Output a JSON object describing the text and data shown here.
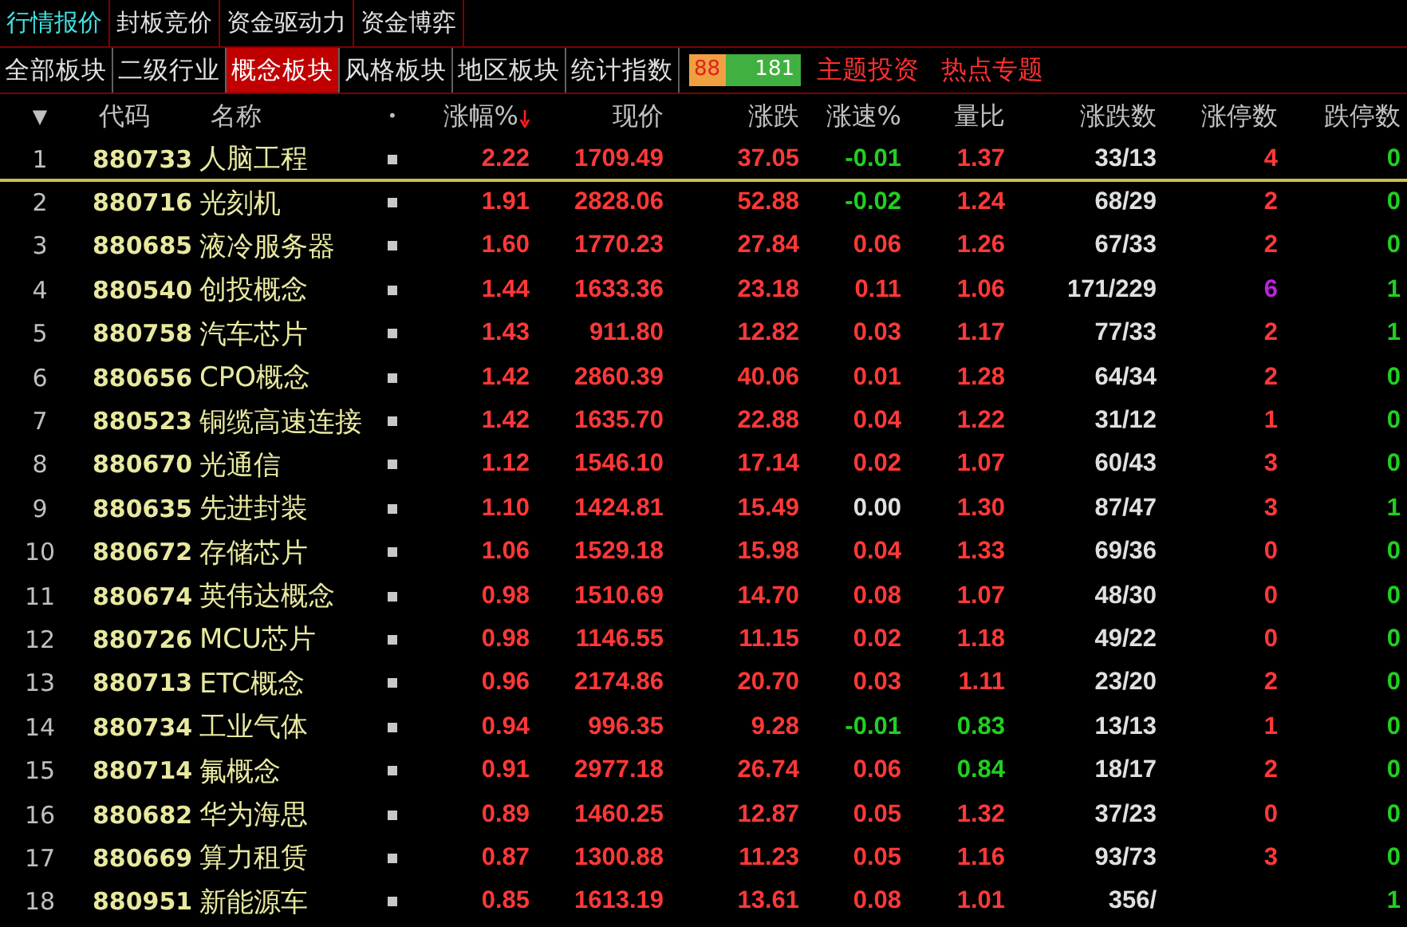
{
  "top_tabs": [
    {
      "label": "行情报价",
      "selected": true
    },
    {
      "label": "封板竞价",
      "selected": false
    },
    {
      "label": "资金驱动力",
      "selected": false
    },
    {
      "label": "资金博弈",
      "selected": false
    }
  ],
  "sector_tabs": [
    {
      "label": "全部板块",
      "selected": false
    },
    {
      "label": "二级行业",
      "selected": false
    },
    {
      "label": "概念板块",
      "selected": true
    },
    {
      "label": "风格板块",
      "selected": false
    },
    {
      "label": "地区板块",
      "selected": false
    },
    {
      "label": "统计指数",
      "selected": false
    }
  ],
  "breadth": {
    "up": "88",
    "down": "181",
    "level": 0.33
  },
  "links": [
    "主题投资",
    "热点专题"
  ],
  "columns": [
    "▼",
    "代码",
    "名称",
    "•",
    "涨幅%",
    "现价",
    "涨跌",
    "涨速%",
    "量比",
    "涨跌数",
    "涨停数",
    "跌停数"
  ],
  "rows": [
    {
      "index": "1",
      "code": "880733",
      "name": "人脑工程",
      "change_pct": "2.22",
      "price": "1709.49",
      "change": "37.05",
      "speed": "-0.01",
      "volume_ratio": "1.37",
      "up_down": "33/13",
      "limit_up": "4",
      "limit_down": "0",
      "limit_up_highlight": false,
      "selected": true
    },
    {
      "index": "2",
      "code": "880716",
      "name": "光刻机",
      "change_pct": "1.91",
      "price": "2828.06",
      "change": "52.88",
      "speed": "-0.02",
      "volume_ratio": "1.24",
      "up_down": "68/29",
      "limit_up": "2",
      "limit_down": "0",
      "limit_up_highlight": false,
      "selected": false
    },
    {
      "index": "3",
      "code": "880685",
      "name": "液冷服务器",
      "change_pct": "1.60",
      "price": "1770.23",
      "change": "27.84",
      "speed": "0.06",
      "volume_ratio": "1.26",
      "up_down": "67/33",
      "limit_up": "2",
      "limit_down": "0",
      "limit_up_highlight": false,
      "selected": false
    },
    {
      "index": "4",
      "code": "880540",
      "name": "创投概念",
      "change_pct": "1.44",
      "price": "1633.36",
      "change": "23.18",
      "speed": "0.11",
      "volume_ratio": "1.06",
      "up_down": "171/229",
      "limit_up": "6",
      "limit_down": "1",
      "limit_up_highlight": true,
      "selected": false
    },
    {
      "index": "5",
      "code": "880758",
      "name": "汽车芯片",
      "change_pct": "1.43",
      "price": "911.80",
      "change": "12.82",
      "speed": "0.03",
      "volume_ratio": "1.17",
      "up_down": "77/33",
      "limit_up": "2",
      "limit_down": "1",
      "limit_up_highlight": false,
      "selected": false
    },
    {
      "index": "6",
      "code": "880656",
      "name": "CPO概念",
      "change_pct": "1.42",
      "price": "2860.39",
      "change": "40.06",
      "speed": "0.01",
      "volume_ratio": "1.28",
      "up_down": "64/34",
      "limit_up": "2",
      "limit_down": "0",
      "limit_up_highlight": false,
      "selected": false
    },
    {
      "index": "7",
      "code": "880523",
      "name": "铜缆高速连接",
      "change_pct": "1.42",
      "price": "1635.70",
      "change": "22.88",
      "speed": "0.04",
      "volume_ratio": "1.22",
      "up_down": "31/12",
      "limit_up": "1",
      "limit_down": "0",
      "limit_up_highlight": false,
      "selected": false
    },
    {
      "index": "8",
      "code": "880670",
      "name": "光通信",
      "change_pct": "1.12",
      "price": "1546.10",
      "change": "17.14",
      "speed": "0.02",
      "volume_ratio": "1.07",
      "up_down": "60/43",
      "limit_up": "3",
      "limit_down": "0",
      "limit_up_highlight": false,
      "selected": false
    },
    {
      "index": "9",
      "code": "880635",
      "name": "先进封装",
      "change_pct": "1.10",
      "price": "1424.81",
      "change": "15.49",
      "speed": "0.00",
      "volume_ratio": "1.30",
      "up_down": "87/47",
      "limit_up": "3",
      "limit_down": "1",
      "limit_up_highlight": false,
      "selected": false
    },
    {
      "index": "10",
      "code": "880672",
      "name": "存储芯片",
      "change_pct": "1.06",
      "price": "1529.18",
      "change": "15.98",
      "speed": "0.04",
      "volume_ratio": "1.33",
      "up_down": "69/36",
      "limit_up": "0",
      "limit_down": "0",
      "limit_up_highlight": false,
      "selected": false
    },
    {
      "index": "11",
      "code": "880674",
      "name": "英伟达概念",
      "change_pct": "0.98",
      "price": "1510.69",
      "change": "14.70",
      "speed": "0.08",
      "volume_ratio": "1.07",
      "up_down": "48/30",
      "limit_up": "0",
      "limit_down": "0",
      "limit_up_highlight": false,
      "selected": false
    },
    {
      "index": "12",
      "code": "880726",
      "name": "MCU芯片",
      "change_pct": "0.98",
      "price": "1146.55",
      "change": "11.15",
      "speed": "0.02",
      "volume_ratio": "1.18",
      "up_down": "49/22",
      "limit_up": "0",
      "limit_down": "0",
      "limit_up_highlight": false,
      "selected": false
    },
    {
      "index": "13",
      "code": "880713",
      "name": "ETC概念",
      "change_pct": "0.96",
      "price": "2174.86",
      "change": "20.70",
      "speed": "0.03",
      "volume_ratio": "1.11",
      "up_down": "23/20",
      "limit_up": "2",
      "limit_down": "0",
      "limit_up_highlight": false,
      "selected": false
    },
    {
      "index": "14",
      "code": "880734",
      "name": "工业气体",
      "change_pct": "0.94",
      "price": "996.35",
      "change": "9.28",
      "speed": "-0.01",
      "volume_ratio": "0.83",
      "up_down": "13/13",
      "limit_up": "1",
      "limit_down": "0",
      "limit_up_highlight": false,
      "selected": false
    },
    {
      "index": "15",
      "code": "880714",
      "name": "氟概念",
      "change_pct": "0.91",
      "price": "2977.18",
      "change": "26.74",
      "speed": "0.06",
      "volume_ratio": "0.84",
      "up_down": "18/17",
      "limit_up": "2",
      "limit_down": "0",
      "limit_up_highlight": false,
      "selected": false
    },
    {
      "index": "16",
      "code": "880682",
      "name": "华为海思",
      "change_pct": "0.89",
      "price": "1460.25",
      "change": "12.87",
      "speed": "0.05",
      "volume_ratio": "1.32",
      "up_down": "37/23",
      "limit_up": "0",
      "limit_down": "0",
      "limit_up_highlight": false,
      "selected": false
    },
    {
      "index": "17",
      "code": "880669",
      "name": "算力租赁",
      "change_pct": "0.87",
      "price": "1300.88",
      "change": "11.23",
      "speed": "0.05",
      "volume_ratio": "1.16",
      "up_down": "93/73",
      "limit_up": "3",
      "limit_down": "0",
      "limit_up_highlight": false,
      "selected": false
    },
    {
      "index": "18",
      "code": "880951",
      "name": "新能源车",
      "change_pct": "0.85",
      "price": "1613.19",
      "change": "13.61",
      "speed": "0.08",
      "volume_ratio": "1.01",
      "up_down": "356/",
      "limit_down": "1",
      "selected": false
    }
  ]
}
